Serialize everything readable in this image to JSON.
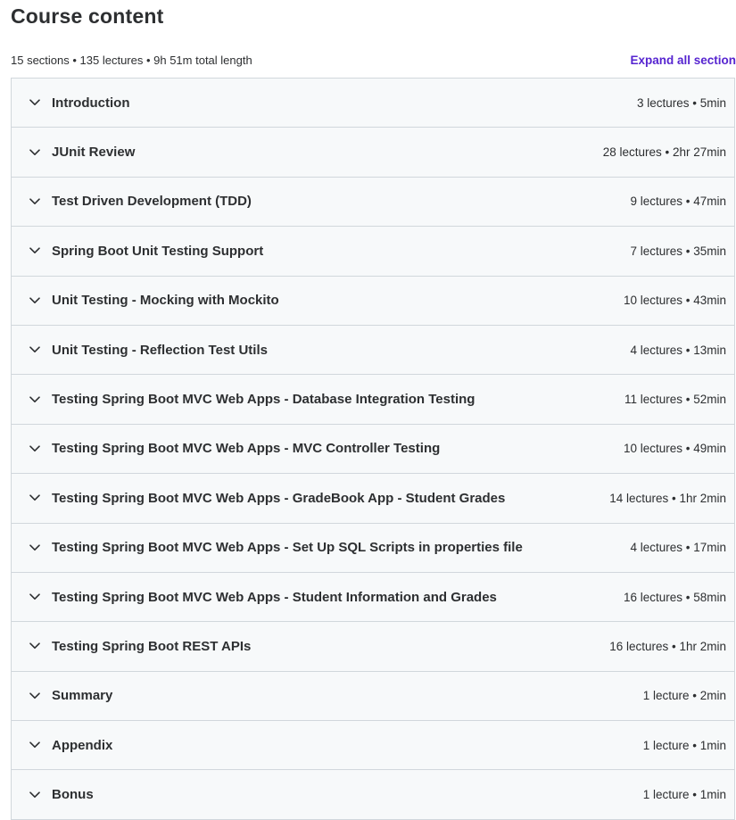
{
  "header": {
    "title": "Course content",
    "summary": "15 sections • 135 lectures • 9h 51m total length",
    "expand_label": "Expand all section"
  },
  "icons": {
    "section_toggle": "chevron-down-icon"
  },
  "colors": {
    "accent": "#5624d0",
    "section_bg": "#f7f9fa",
    "border": "#d1d7dc",
    "text": "#2d2f31"
  },
  "sections": [
    {
      "title": "Introduction",
      "meta": "3 lectures • 5min"
    },
    {
      "title": "JUnit Review",
      "meta": "28 lectures • 2hr 27min"
    },
    {
      "title": "Test Driven Development (TDD)",
      "meta": "9 lectures • 47min"
    },
    {
      "title": "Spring Boot Unit Testing Support",
      "meta": "7 lectures • 35min"
    },
    {
      "title": "Unit Testing - Mocking with Mockito",
      "meta": "10 lectures • 43min"
    },
    {
      "title": "Unit Testing - Reflection Test Utils",
      "meta": "4 lectures • 13min"
    },
    {
      "title": "Testing Spring Boot MVC Web Apps - Database Integration Testing",
      "meta": "11 lectures • 52min"
    },
    {
      "title": "Testing Spring Boot MVC Web Apps - MVC Controller Testing",
      "meta": "10 lectures • 49min"
    },
    {
      "title": "Testing Spring Boot MVC Web Apps - GradeBook App - Student Grades",
      "meta": "14 lectures • 1hr 2min"
    },
    {
      "title": "Testing Spring Boot MVC Web Apps - Set Up SQL Scripts in properties file",
      "meta": "4 lectures • 17min"
    },
    {
      "title": "Testing Spring Boot MVC Web Apps - Student Information and Grades",
      "meta": "16 lectures • 58min"
    },
    {
      "title": "Testing Spring Boot REST APIs",
      "meta": "16 lectures • 1hr 2min"
    },
    {
      "title": "Summary",
      "meta": "1 lecture • 2min"
    },
    {
      "title": "Appendix",
      "meta": "1 lecture • 1min"
    },
    {
      "title": "Bonus",
      "meta": "1 lecture • 1min"
    }
  ]
}
